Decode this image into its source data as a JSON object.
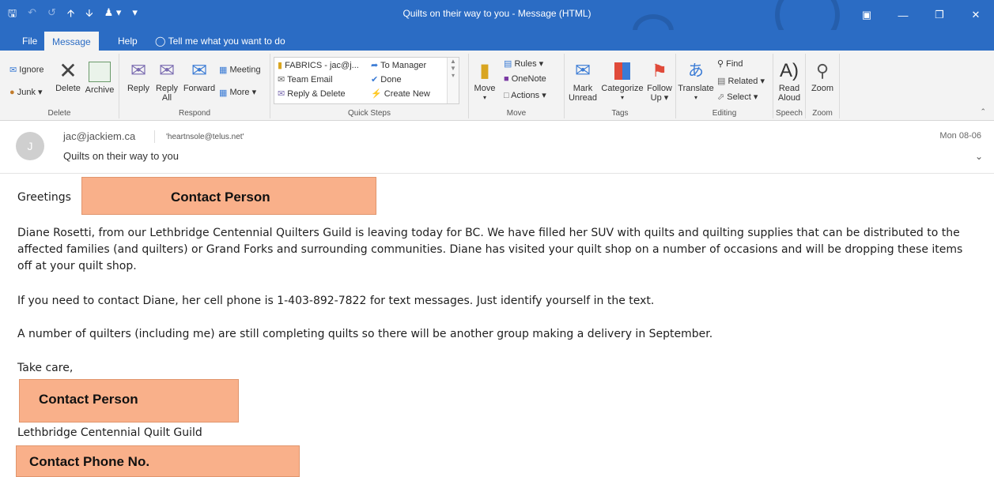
{
  "window": {
    "title": "Quilts on their way to you  -  Message (HTML)"
  },
  "tabs": [
    {
      "label": "File"
    },
    {
      "label": "Message"
    },
    {
      "label": "Help"
    },
    {
      "label": "Tell me what you want to do"
    }
  ],
  "ribbon": {
    "delete_group": {
      "ignore": "Ignore",
      "junk": "Junk",
      "delete": "Delete",
      "archive": "Archive",
      "label": "Delete"
    },
    "respond_group": {
      "reply": "Reply",
      "reply_all_1": "Reply",
      "reply_all_2": "All",
      "forward": "Forward",
      "meeting": "Meeting",
      "more": "More",
      "label": "Respond"
    },
    "quick_steps": {
      "items": [
        "FABRICS - jac@j...",
        "To Manager",
        "Team Email",
        "Done",
        "Reply & Delete",
        "Create New"
      ],
      "label": "Quick Steps"
    },
    "move_group": {
      "move": "Move",
      "rules": "Rules",
      "onenote": "OneNote",
      "actions": "Actions",
      "label": "Move"
    },
    "tags_group": {
      "mark_unread_1": "Mark",
      "mark_unread_2": "Unread",
      "categorize": "Categorize",
      "follow_up_1": "Follow",
      "follow_up_2": "Up",
      "label": "Tags"
    },
    "editing_group": {
      "translate": "Translate",
      "find": "Find",
      "related": "Related",
      "select": "Select",
      "label": "Editing"
    },
    "speech_group": {
      "read_aloud_1": "Read",
      "read_aloud_2": "Aloud",
      "label": "Speech"
    },
    "zoom_group": {
      "zoom": "Zoom",
      "label": "Zoom"
    }
  },
  "message": {
    "avatar_initial": "J",
    "from": "jac@jackiem.ca",
    "to": "'heartnsole@telus.net'",
    "subject": "Quilts on their way to you",
    "date": "Mon 08-06"
  },
  "body": {
    "greeting": "Greetings",
    "paragraph1": "Diane Rosetti, from our Lethbridge Centennial Quilters Guild is leaving today for BC.  We have filled her SUV with quilts and quilting supplies that can be distributed to the affected families (and quilters) or Grand Forks and surrounding communities.  Diane has visited your quilt shop on a number of occasions and will be dropping these items off at your quilt shop.",
    "paragraph2": "If you need to contact Diane, her cell phone is 1-403-892-7822 for text messages.  Just identify yourself in the text.",
    "paragraph3": "A number of quilters (including me) are still completing quilts so there will be another group making a delivery in September.",
    "closing": "Take care,",
    "guild": "Lethbridge Centennial Quilt Guild"
  },
  "callouts": {
    "contact_person_1": "Contact Person",
    "contact_person_2": "Contact Person",
    "contact_phone": "Contact Phone No."
  },
  "colors": {
    "accent": "#2b6cc4",
    "callout_fill": "#f9b08a"
  }
}
